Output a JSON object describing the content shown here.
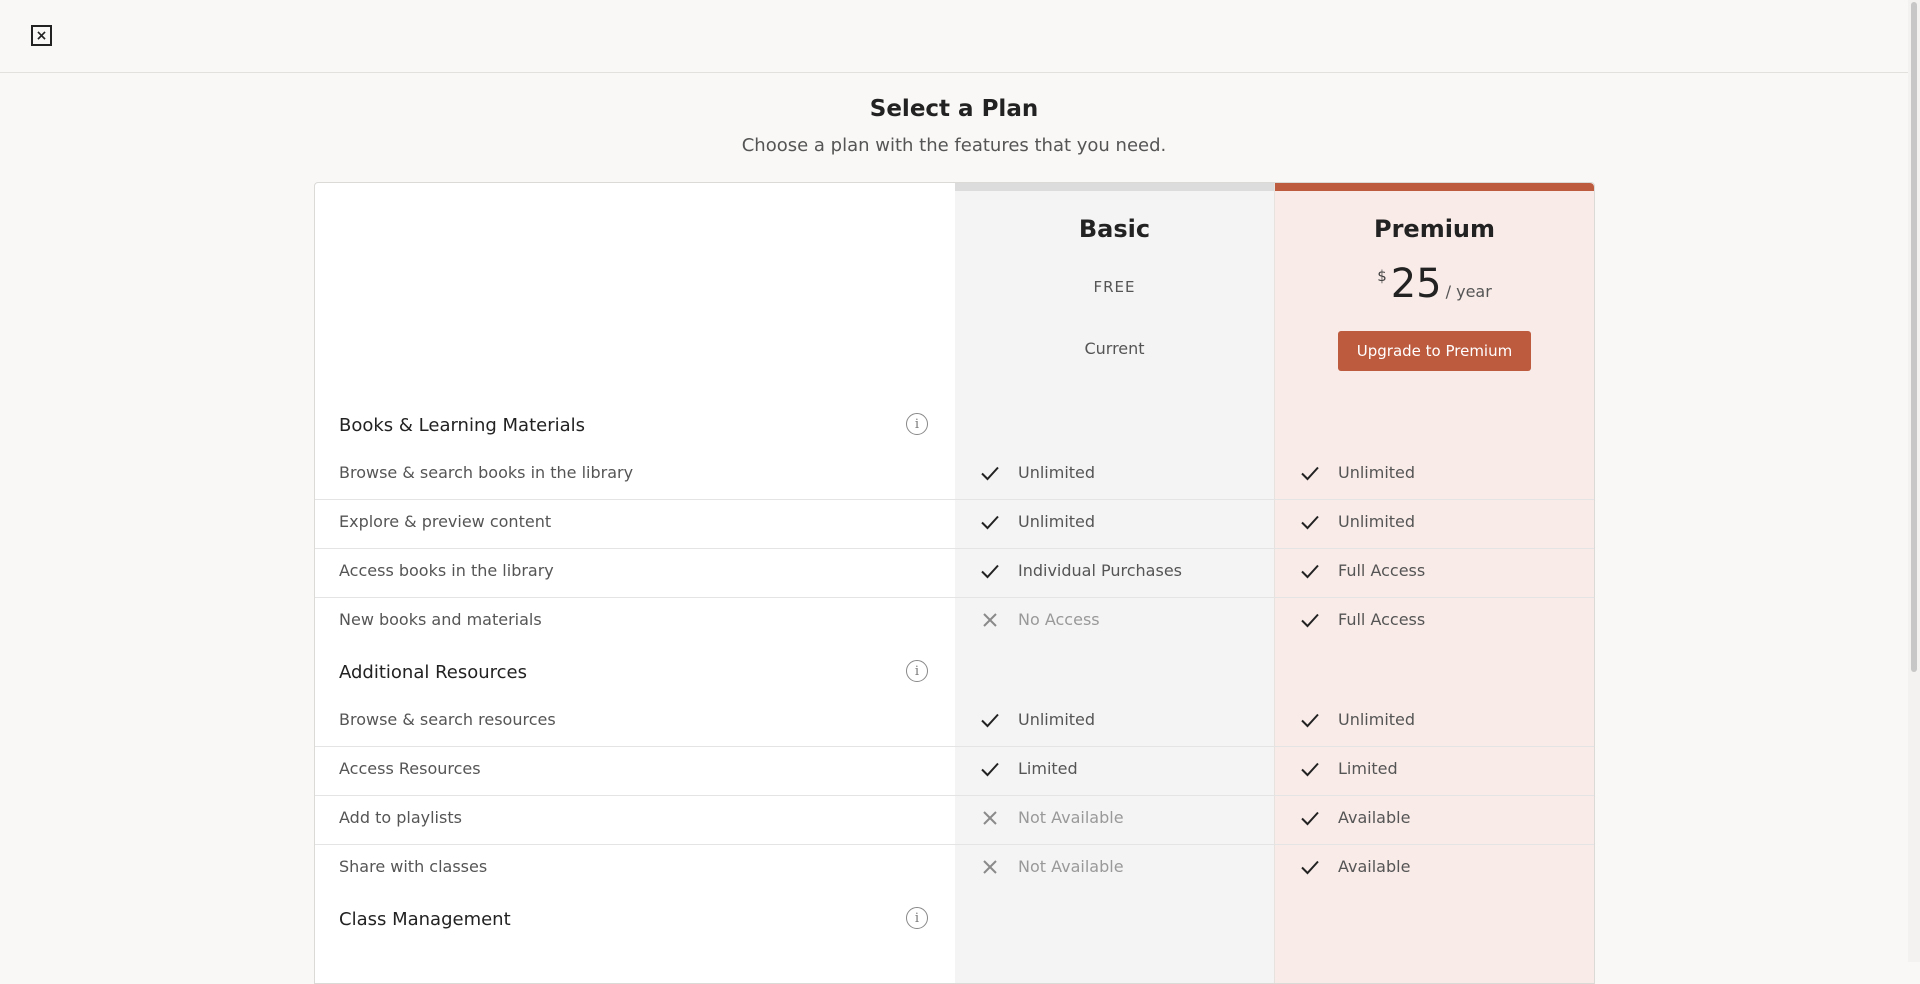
{
  "header": {
    "close_label": "×"
  },
  "page": {
    "title": "Select a Plan",
    "subtitle": "Choose a plan with the features that you need."
  },
  "plans": {
    "basic": {
      "name": "Basic",
      "price_label": "FREE",
      "status": "Current"
    },
    "premium": {
      "name": "Premium",
      "currency": "$",
      "amount": "25",
      "period": "/ year",
      "cta": "Upgrade to Premium",
      "accent_color": "#bd5b3f"
    }
  },
  "sections": [
    {
      "title": "Books & Learning Materials",
      "rows": [
        {
          "label": "Browse & search books in the library",
          "basic": {
            "icon": "check-icon",
            "text": "Unlimited"
          },
          "premium": {
            "icon": "check-icon",
            "text": "Unlimited"
          }
        },
        {
          "label": "Explore & preview content",
          "basic": {
            "icon": "check-icon",
            "text": "Unlimited"
          },
          "premium": {
            "icon": "check-icon",
            "text": "Unlimited"
          }
        },
        {
          "label": "Access books in the library",
          "basic": {
            "icon": "check-icon",
            "text": "Individual Purchases"
          },
          "premium": {
            "icon": "check-icon",
            "text": "Full Access"
          }
        },
        {
          "label": "New books and materials",
          "basic": {
            "icon": "x-icon",
            "text": "No Access"
          },
          "premium": {
            "icon": "check-icon",
            "text": "Full Access"
          }
        }
      ]
    },
    {
      "title": "Additional Resources",
      "rows": [
        {
          "label": "Browse & search resources",
          "basic": {
            "icon": "check-icon",
            "text": "Unlimited"
          },
          "premium": {
            "icon": "check-icon",
            "text": "Unlimited"
          }
        },
        {
          "label": "Access Resources",
          "basic": {
            "icon": "check-icon",
            "text": "Limited"
          },
          "premium": {
            "icon": "check-icon",
            "text": "Limited"
          }
        },
        {
          "label": "Add to playlists",
          "basic": {
            "icon": "x-icon",
            "text": "Not Available"
          },
          "premium": {
            "icon": "check-icon",
            "text": "Available"
          }
        },
        {
          "label": "Share with classes",
          "basic": {
            "icon": "x-icon",
            "text": "Not Available"
          },
          "premium": {
            "icon": "check-icon",
            "text": "Available"
          }
        }
      ]
    },
    {
      "title": "Class Management",
      "rows": []
    }
  ]
}
